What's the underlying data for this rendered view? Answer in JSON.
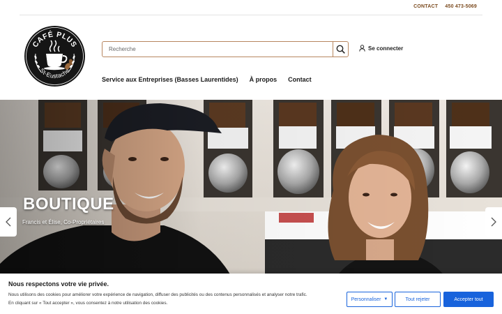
{
  "topbar": {
    "contact_label": "CONTACT",
    "phone": "450 473-5069"
  },
  "logo": {
    "line1": "CAFÉ PLUS",
    "line2": "St-Eustache"
  },
  "search": {
    "placeholder": "Recherche"
  },
  "header": {
    "login_label": "Se connecter"
  },
  "nav": {
    "items": [
      {
        "label": "Service aux Entreprises (Basses Laurentides)"
      },
      {
        "label": "À propos"
      },
      {
        "label": "Contact"
      }
    ]
  },
  "hero": {
    "title": "BOUTIQUE",
    "subtitle": "Francis et Élise, Co-Propriétaires"
  },
  "cookie": {
    "title": "Nous respectons votre vie privée.",
    "text_line1": "Nous utilisons des cookies pour améliorer votre expérience de navigation, diffuser des publicités ou des contenus personnalisés et analyser notre trafic.",
    "text_line2": "En cliquant sur « Tout accepter », vous consentez à notre utilisation des cookies.",
    "customize_label": "Personnaliser",
    "reject_label": "Tout rejeter",
    "accept_label": "Accepter tout"
  },
  "colors": {
    "brand_brown": "#7b4a1e",
    "search_border": "#b7865f",
    "cookie_blue": "#1863dc"
  }
}
